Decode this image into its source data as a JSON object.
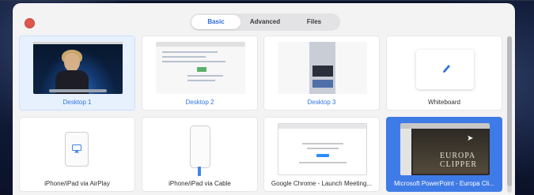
{
  "tabs": [
    {
      "label": "Basic",
      "active": true
    },
    {
      "label": "Advanced",
      "active": false
    },
    {
      "label": "Files",
      "active": false
    }
  ],
  "tiles": [
    {
      "label": "Desktop 1",
      "icon": "desktop-screenshot"
    },
    {
      "label": "Desktop 2",
      "icon": "desktop-screenshot"
    },
    {
      "label": "Desktop 3",
      "icon": "desktop-screenshot"
    },
    {
      "label": "Whiteboard",
      "icon": "pencil-icon"
    },
    {
      "label": "iPhone/iPad via AirPlay",
      "icon": "airplay-icon"
    },
    {
      "label": "iPhone/iPad via Cable",
      "icon": "iphone-cable-icon"
    },
    {
      "label": "Google Chrome - Launch Meeting...",
      "icon": "window-screenshot"
    },
    {
      "label": "Microsoft PowerPoint - Europa Cli...",
      "icon": "window-screenshot",
      "slide_text": "EUROPA CLIPPER"
    }
  ],
  "colors": {
    "accent": "#3f7be6",
    "close": "#e0564c"
  }
}
